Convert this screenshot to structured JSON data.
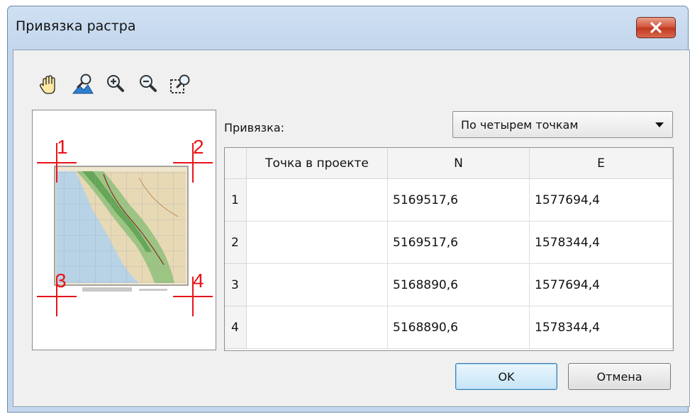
{
  "window": {
    "title": "Привязка растра",
    "close_label": "✕"
  },
  "toolbar": {
    "icons": [
      "hand-pan-icon",
      "zoom-extent-icon",
      "zoom-in-icon",
      "zoom-out-icon",
      "zoom-window-icon"
    ]
  },
  "preview": {
    "markers": [
      "1",
      "2",
      "3",
      "4"
    ],
    "colors": {
      "marker": "#e8141a",
      "sea": "#b8d3e6",
      "land": "#e8d9b5",
      "forest": "#8ec07a"
    }
  },
  "binding": {
    "label": "Привязка:",
    "selected": "По четырем точкам"
  },
  "table": {
    "columns": [
      "Точка в проекте",
      "N",
      "E"
    ],
    "rows": [
      {
        "num": "1",
        "point": "",
        "n": "5169517,6",
        "e": "1577694,4"
      },
      {
        "num": "2",
        "point": "",
        "n": "5169517,6",
        "e": "1578344,4"
      },
      {
        "num": "3",
        "point": "",
        "n": "5168890,6",
        "e": "1577694,4"
      },
      {
        "num": "4",
        "point": "",
        "n": "5168890,6",
        "e": "1578344,4"
      }
    ]
  },
  "buttons": {
    "ok": "OK",
    "cancel": "Отмена"
  }
}
